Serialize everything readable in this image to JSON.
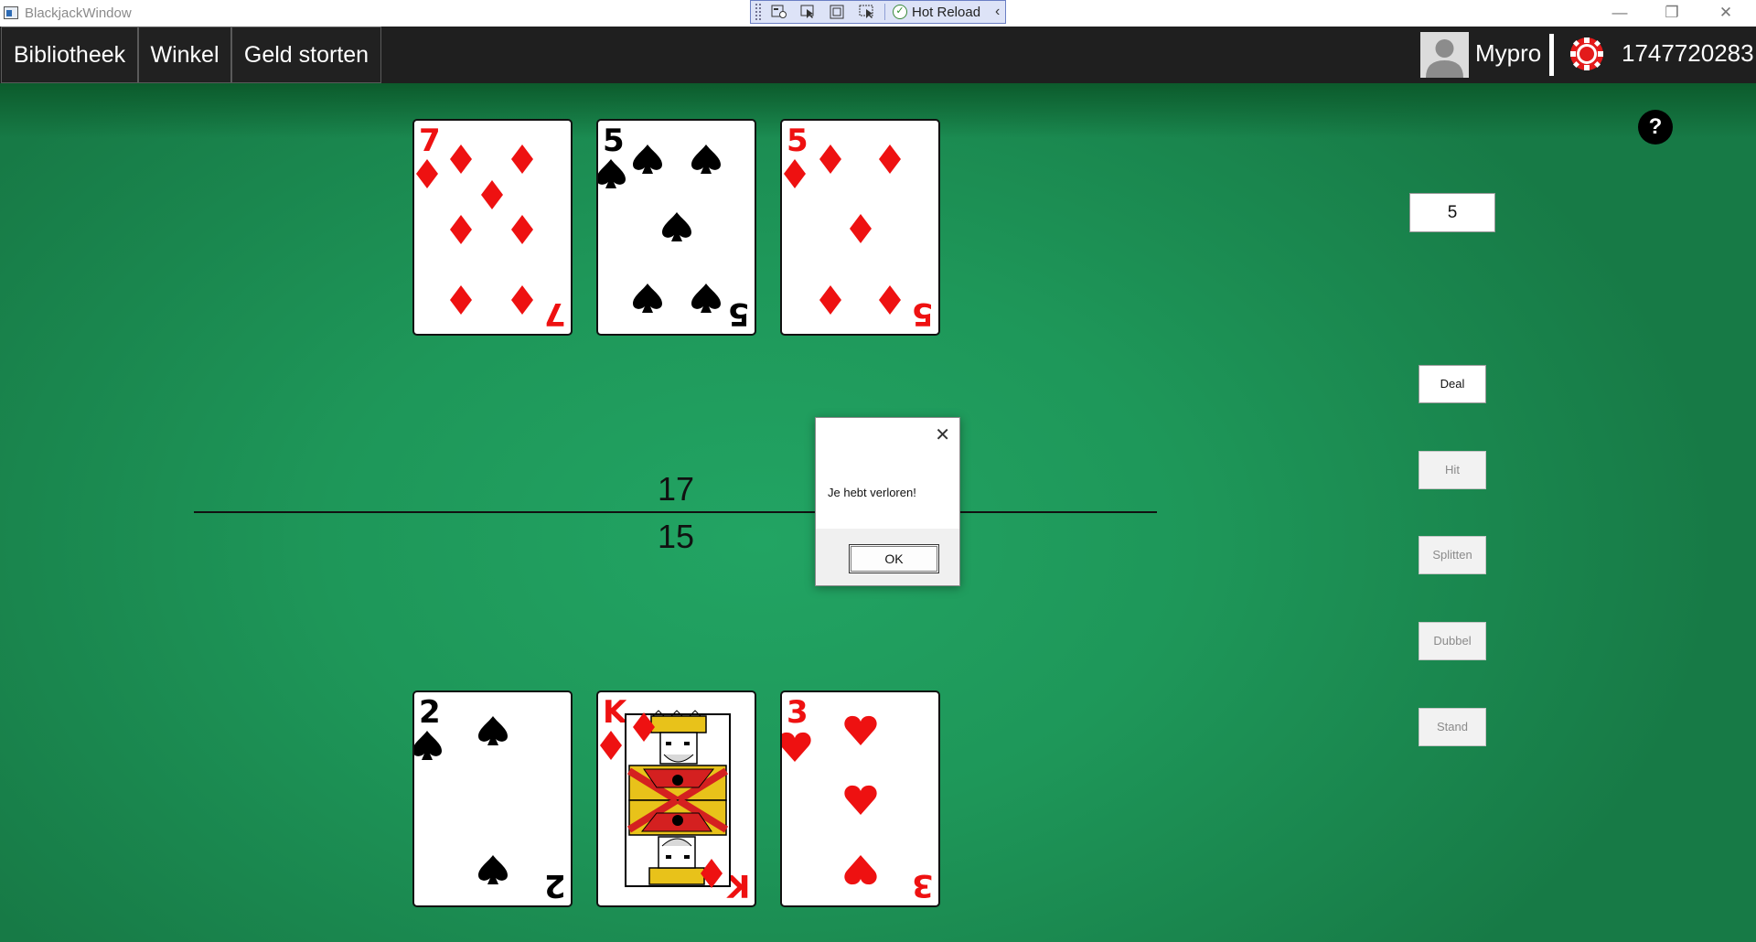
{
  "window": {
    "title": "BlackjackWindow",
    "debug_toolbar": {
      "hot_reload_label": "Hot Reload"
    },
    "controls": {
      "minimize": "—",
      "restore": "❐",
      "close": "✕"
    }
  },
  "nav": {
    "items": [
      {
        "label": "Bibliotheek"
      },
      {
        "label": "Winkel"
      },
      {
        "label": "Geld storten"
      }
    ],
    "username": "Mypro",
    "balance": "1747720283"
  },
  "table": {
    "dealer_cards": [
      {
        "rank": "7",
        "suit": "diamonds",
        "color": "red"
      },
      {
        "rank": "5",
        "suit": "spades",
        "color": "black"
      },
      {
        "rank": "5",
        "suit": "diamonds",
        "color": "red"
      }
    ],
    "player_cards": [
      {
        "rank": "2",
        "suit": "spades",
        "color": "black"
      },
      {
        "rank": "K",
        "suit": "diamonds",
        "color": "red"
      },
      {
        "rank": "3",
        "suit": "hearts",
        "color": "red"
      }
    ],
    "dealer_score": "17",
    "player_score": "15"
  },
  "controls": {
    "help_label": "?",
    "bet_value": "5",
    "buttons": [
      {
        "label": "Deal",
        "enabled": true
      },
      {
        "label": "Hit",
        "enabled": false
      },
      {
        "label": "Splitten",
        "enabled": false
      },
      {
        "label": "Dubbel",
        "enabled": false
      },
      {
        "label": "Stand",
        "enabled": false
      }
    ]
  },
  "dialog": {
    "message": "Je hebt verloren!",
    "ok_label": "OK",
    "close_label": "✕"
  },
  "colors": {
    "felt": "#1e9759",
    "navbar": "#1f1f1f",
    "card_red": "#ee1111",
    "card_black": "#000000"
  }
}
